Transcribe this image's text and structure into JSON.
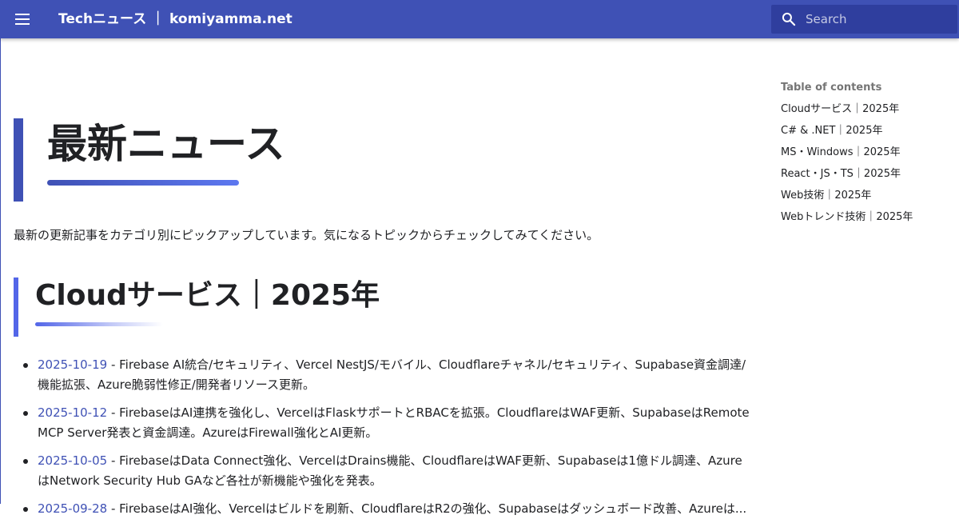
{
  "header": {
    "site_title": "Techニュース ｜ komiyamma.net",
    "search_placeholder": "Search"
  },
  "main": {
    "page_title": "最新ニュース",
    "intro": "最新の更新記事をカテゴリ別にピックアップしています。気になるトピックからチェックしてみてください。",
    "section_title": "Cloudサービス｜2025年",
    "news": [
      {
        "date": "2025-10-19",
        "text": " - Firebase AI統合/セキュリティ、Vercel NestJS/モバイル、Cloudflareチャネル/セキュリティ、Supabase資金調達/機能拡張、Azure脆弱性修正/開発者リソース更新。"
      },
      {
        "date": "2025-10-12",
        "text": " - FirebaseはAI連携を強化し、VercelはFlaskサポートとRBACを拡張。CloudflareはWAF更新、SupabaseはRemote MCP Server発表と資金調達。AzureはFirewall強化とAI更新。"
      },
      {
        "date": "2025-10-05",
        "text": " - FirebaseはData Connect強化、VercelはDrains機能、CloudflareはWAF更新、Supabaseは1億ドル調達、AzureはNetwork Security Hub GAなど各社が新機能や強化を発表。"
      },
      {
        "date": "2025-09-28",
        "text": " - FirebaseはAI強化、Vercelはビルドを刷新、CloudflareはR2の強化、Supabaseはダッシュボード改善、Azureは..."
      }
    ]
  },
  "toc": {
    "title": "Table of contents",
    "items": [
      "Cloudサービス｜2025年",
      "C# & .NET｜2025年",
      "MS・Windows｜2025年",
      "React・JS・TS｜2025年",
      "Web技術｜2025年",
      "Webトレンド技術｜2025年"
    ]
  },
  "colors": {
    "header_bg": "#3f51b5",
    "link": "#3f51b5",
    "accent": "#5366e8"
  }
}
